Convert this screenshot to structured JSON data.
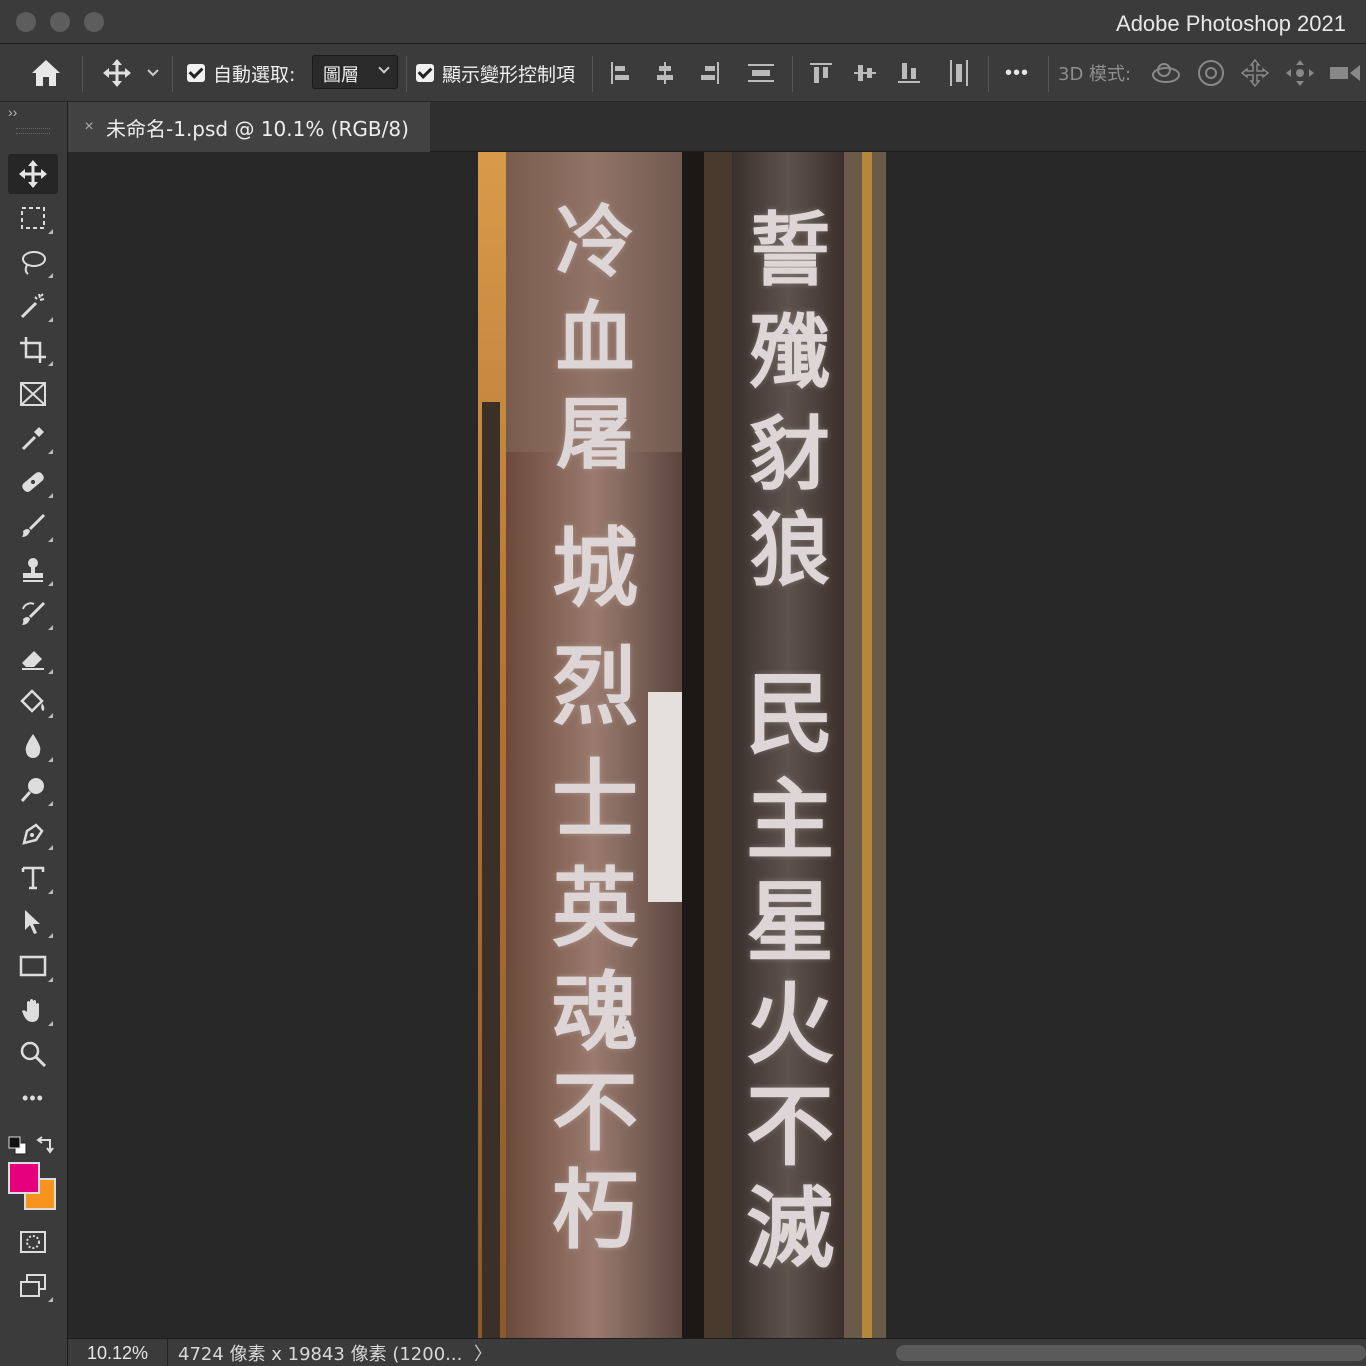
{
  "window": {
    "app_title": "Adobe Photoshop 2021"
  },
  "options_bar": {
    "auto_select_label": "自動選取:",
    "auto_select_value": "圖層",
    "show_transform_label": "顯示變形控制項",
    "more_label": "•••",
    "mode_3d_label": "3D 模式:"
  },
  "tab": {
    "title": "未命名-1.psd @ 10.1% (RGB/8)",
    "close": "×"
  },
  "toolbar": {
    "collapse": "››",
    "more": "•••",
    "foreground_color": "#e6007e",
    "background_color": "#f7941d"
  },
  "canvas": {
    "left_column_text": [
      "冷",
      "血",
      "屠",
      "城",
      "烈",
      "士",
      "英",
      "魂",
      "不",
      "朽"
    ],
    "right_column_text": [
      "誓",
      "殲",
      "豺",
      "狼",
      "民",
      "主",
      "星",
      "火",
      "不",
      "滅"
    ]
  },
  "status": {
    "zoom": "10.12%",
    "doc_info": "4724 像素 x 19843 像素 (1200...",
    "arrow": "〉"
  }
}
